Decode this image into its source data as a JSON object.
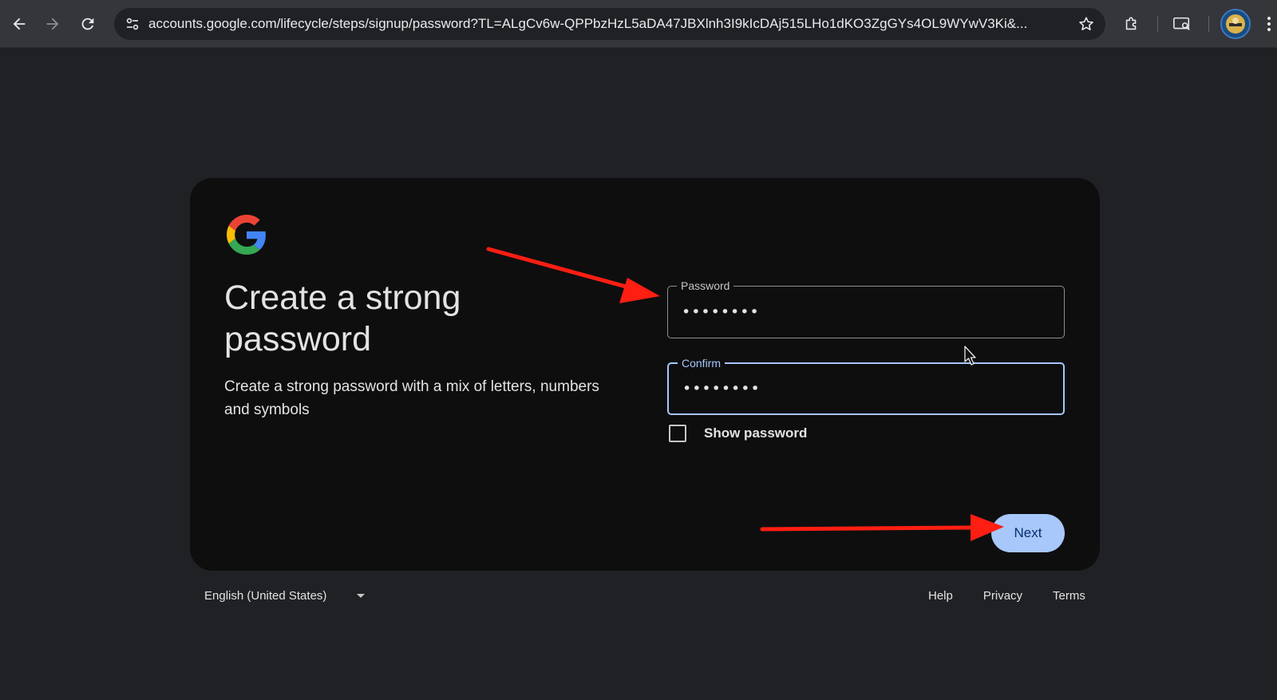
{
  "browser": {
    "url": "accounts.google.com/lifecycle/steps/signup/password?TL=ALgCv6w-QPPbzHzL5aDA47JBXlnh3I9kIcDAj515LHo1dKO3ZgGYs4OL9WYwV3Ki&..."
  },
  "page": {
    "heading": "Create a strong password",
    "subtext": "Create a strong password with a mix of letters, numbers and symbols"
  },
  "form": {
    "password_label": "Password",
    "password_value": "••••••••",
    "confirm_label": "Confirm",
    "confirm_value": "••••••••",
    "show_password_label": "Show password",
    "show_password_checked": false,
    "next_label": "Next"
  },
  "footer": {
    "language": "English (United States)",
    "links": [
      "Help",
      "Privacy",
      "Terms"
    ]
  },
  "colors": {
    "accent": "#a8c7fa",
    "button_text": "#062e6f",
    "annotation_arrow": "#ff1e12",
    "card_bg": "#0e0e0f",
    "page_bg": "#202124"
  },
  "icons": {
    "back": "arrow-left-icon",
    "forward": "arrow-right-icon",
    "reload": "reload-icon",
    "site_info": "tune-icon",
    "bookmark": "star-icon",
    "extensions": "puzzle-icon",
    "cast": "cast-search-icon",
    "menu": "kebab-menu-icon",
    "logo": "google-g-logo"
  }
}
